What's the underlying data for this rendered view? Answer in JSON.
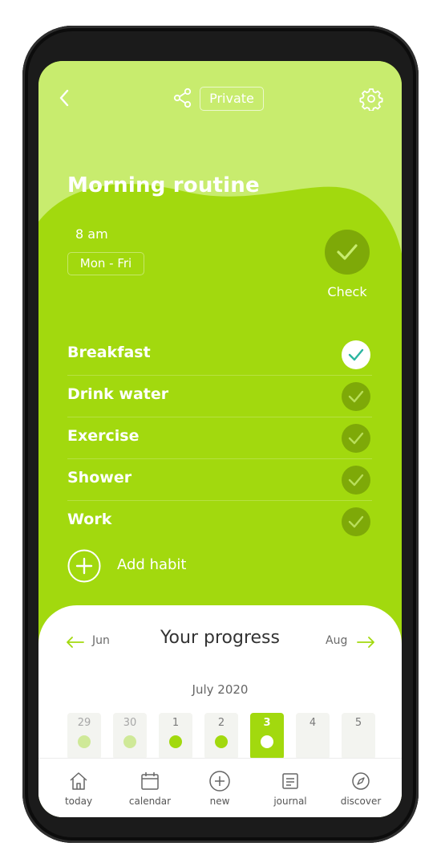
{
  "header": {
    "privacy_label": "Private"
  },
  "routine": {
    "title": "Morning routine",
    "time": "8 am",
    "days": "Mon - Fri",
    "check_label": "Check"
  },
  "habits": [
    {
      "label": "Breakfast",
      "completed": true
    },
    {
      "label": "Drink water",
      "completed": false
    },
    {
      "label": "Exercise",
      "completed": false
    },
    {
      "label": "Shower",
      "completed": false
    },
    {
      "label": "Work",
      "completed": false
    }
  ],
  "add_habit_label": "Add habit",
  "progress": {
    "title": "Your progress",
    "prev_month": "Jun",
    "next_month": "Aug",
    "month_year": "July 2020",
    "days": [
      {
        "num": "29",
        "state": "past"
      },
      {
        "num": "30",
        "state": "past"
      },
      {
        "num": "1",
        "state": "done"
      },
      {
        "num": "2",
        "state": "done"
      },
      {
        "num": "3",
        "state": "today"
      },
      {
        "num": "4",
        "state": "future"
      },
      {
        "num": "5",
        "state": "future"
      }
    ]
  },
  "tabs": [
    {
      "label": "today",
      "icon": "home-icon"
    },
    {
      "label": "calendar",
      "icon": "calendar-icon"
    },
    {
      "label": "new",
      "icon": "plus-circle-icon"
    },
    {
      "label": "journal",
      "icon": "journal-icon"
    },
    {
      "label": "discover",
      "icon": "compass-icon"
    }
  ],
  "colors": {
    "accent": "#a2d90e",
    "accent_light": "#c8ec6e",
    "check_dark": "#7ea908",
    "check_done": "#2bb5a0"
  }
}
